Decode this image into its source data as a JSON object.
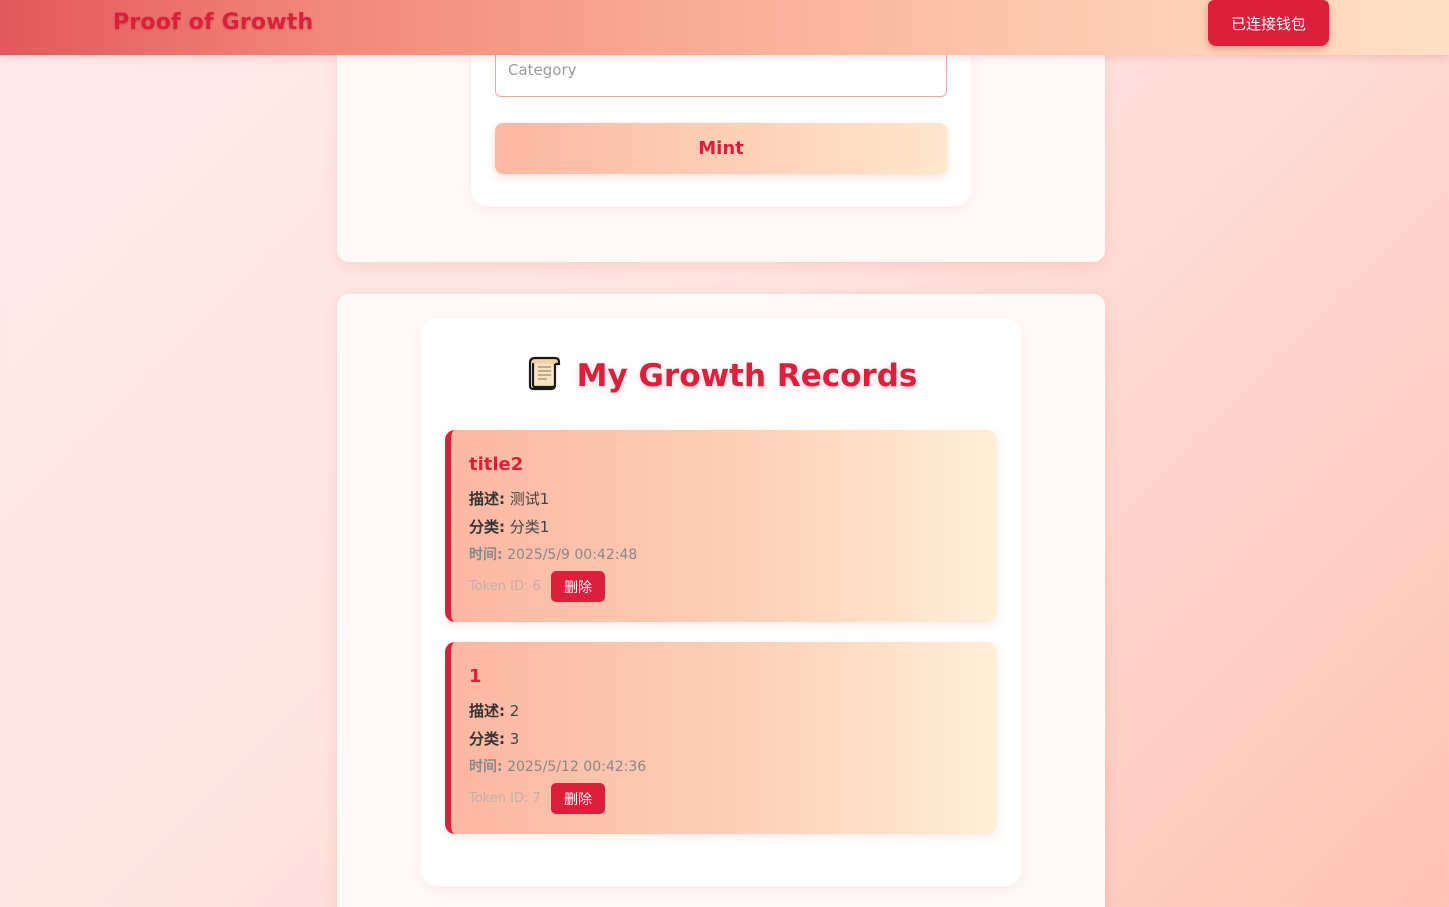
{
  "navbar": {
    "brand": "Proof of Growth",
    "wallet_button": "已连接钱包"
  },
  "mint_form": {
    "category_placeholder": "Category",
    "category_value": "",
    "mint_button": "Mint"
  },
  "records": {
    "title": "My Growth Records",
    "title_icon": "scroll-icon",
    "desc_label": "描述:",
    "category_label": "分类:",
    "time_label": "时间:",
    "delete_label": "删除",
    "items": [
      {
        "title": "title2",
        "description": "测试1",
        "category": "分类1",
        "time": "2025/5/9 00:42:48",
        "token": "Token ID: 6"
      },
      {
        "title": "1",
        "description": "2",
        "category": "3",
        "time": "2025/5/12 00:42:36",
        "token": "Token ID: 7"
      }
    ]
  },
  "colors": {
    "accent": "#dc1f3a",
    "card_gradient_start": "#fcb7a2",
    "card_gradient_end": "#ffeed8"
  }
}
